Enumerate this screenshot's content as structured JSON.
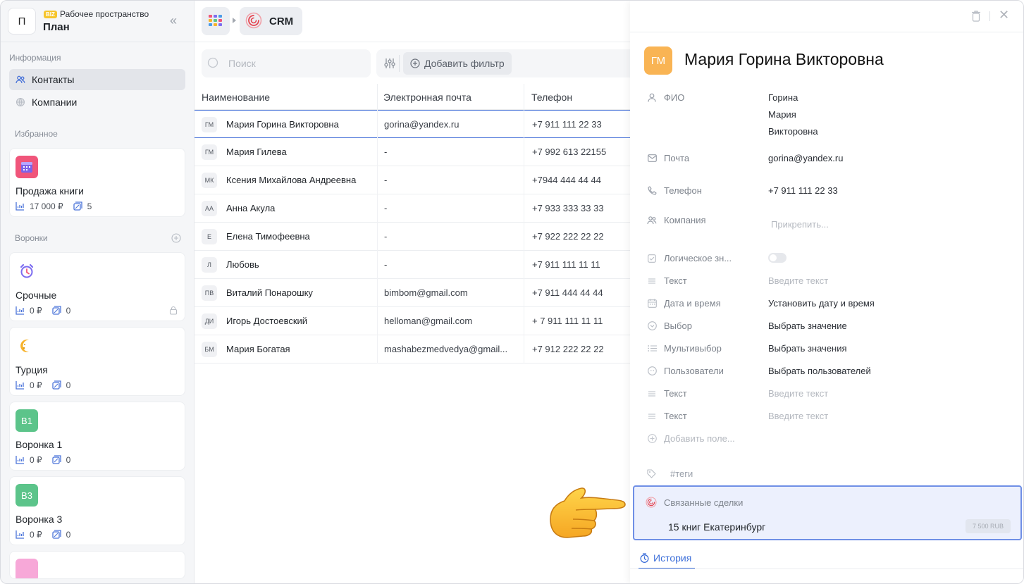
{
  "workspace": {
    "avatar_letter": "П",
    "badge": "BIZ",
    "subtitle": "Рабочее пространство",
    "title": "План"
  },
  "sidebar": {
    "section_info": "Информация",
    "items": [
      {
        "label": "Контакты",
        "active": true
      },
      {
        "label": "Компании",
        "active": false
      }
    ],
    "section_favorites": "Избранное",
    "section_funnels": "Воронки",
    "cards": [
      {
        "title": "Продажа книги",
        "icon": "calendar-icon",
        "icon_text": "",
        "color": "#f0557a",
        "amount": "17 000 ₽",
        "count": "5"
      },
      {
        "title": "Срочные",
        "icon": "alarm-clock-icon",
        "icon_text": "",
        "color": "#ffffff",
        "amount": "0 ₽",
        "count": "0",
        "locked": true
      },
      {
        "title": "Турция",
        "icon": "crescent-moon-icon",
        "icon_text": "",
        "color": "#ffffff",
        "amount": "0 ₽",
        "count": "0"
      },
      {
        "title": "Воронка 1",
        "icon": "text-badge",
        "icon_text": "В1",
        "color": "#5cc48a",
        "amount": "0 ₽",
        "count": "0"
      },
      {
        "title": "Воронка 3",
        "icon": "text-badge",
        "icon_text": "В3",
        "color": "#5cc48a",
        "amount": "0 ₽",
        "count": "0"
      }
    ]
  },
  "breadcrumb": {
    "current": "CRM"
  },
  "search": {
    "placeholder": "Поиск"
  },
  "filters": {
    "add_label": "Добавить фильтр"
  },
  "table": {
    "columns": [
      "Наименование",
      "Электронная почта",
      "Телефон"
    ],
    "rows": [
      {
        "initials": "ГМ",
        "name": "Мария Горина Викторовна",
        "email": "gorina@yandex.ru",
        "phone": "+7 911 111 22 33",
        "selected": true
      },
      {
        "initials": "ГМ",
        "name": "Мария Гилева",
        "email": "-",
        "phone": "+7 992 613 22155"
      },
      {
        "initials": "МК",
        "name": "Ксения Михайлова Андреевна",
        "email": "-",
        "phone": "+7944 444 44 44"
      },
      {
        "initials": "АА",
        "name": "Анна Акула",
        "email": "-",
        "phone": "+7 933 333 33 33"
      },
      {
        "initials": "Е",
        "name": "Елена Тимофеевна",
        "email": "-",
        "phone": "+7 922 222 22 22"
      },
      {
        "initials": "Л",
        "name": "Любовь",
        "email": "-",
        "phone": "+7 911 111 11 11"
      },
      {
        "initials": "ПВ",
        "name": "Виталий Понарошку",
        "email": "bimbom@gmail.com",
        "phone": "+7 911 444 44 44"
      },
      {
        "initials": "ДИ",
        "name": "Игорь Достоевский",
        "email": "helloman@gmail.com",
        "phone": "+ 7 911 111 11 11"
      },
      {
        "initials": "БМ",
        "name": "Мария Богатая",
        "email": "mashabezmedvedya@gmail...",
        "phone": "+7 912 222 22 22"
      }
    ]
  },
  "contact": {
    "initials": "ГМ",
    "name": "Мария Горина Викторовна",
    "fields": {
      "fio_label": "ФИО",
      "fio_last": "Горина",
      "fio_first": "Мария",
      "fio_middle": "Викторовна",
      "email_label": "Почта",
      "email_value": "gorina@yandex.ru",
      "phone_label": "Телефон",
      "phone_value": "+7 911 111 22 33",
      "company_label": "Компания",
      "company_value": "Прикрепить...",
      "bool_label": "Логическое зн...",
      "text1_label": "Текст",
      "text1_placeholder": "Введите текст",
      "datetime_label": "Дата и время",
      "datetime_value": "Установить дату и время",
      "choice_label": "Выбор",
      "choice_value": "Выбрать значение",
      "multi_label": "Мультивыбор",
      "multi_value": "Выбрать значения",
      "users_label": "Пользователи",
      "users_value": "Выбрать пользователей",
      "text2_label": "Текст",
      "text2_placeholder": "Введите текст",
      "text3_label": "Текст",
      "text3_placeholder": "Введите текст",
      "add_field": "Добавить поле..."
    },
    "tags_placeholder": "#теги",
    "related": {
      "title": "Связанные сделки",
      "deal_name": "15 книг Екатеринбург",
      "deal_amount": "7 500 RUB"
    },
    "history_tab": "История"
  },
  "colors": {
    "accent": "#3d6fd9",
    "selected_row_border": "#4a74d9",
    "related_bg": "#ecf0fd",
    "avatar_bg": "#f9b454"
  }
}
